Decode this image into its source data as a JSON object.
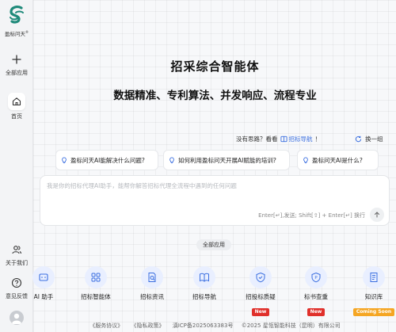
{
  "sidebar": {
    "logo_text": "盈标问天",
    "logo_mark": "®",
    "items": [
      {
        "label": "全部应用",
        "icon": "plus-icon"
      },
      {
        "label": "首页",
        "icon": "home-icon"
      },
      {
        "label": "关于我们",
        "icon": "users-icon"
      },
      {
        "label": "意见反馈",
        "icon": "help-icon"
      }
    ]
  },
  "main": {
    "title": "招采综合智能体",
    "subtitle": "数据精准、专利算法、并发响应、流程专业",
    "hint_prefix": "没有思路？看看",
    "hint_link": "招标导航",
    "hint_suffix": "！",
    "refresh_label": "换一组",
    "suggestions": [
      "盈标问天AI能解决什么问题?",
      "如何利用盈标问天开展AI赋能的培训?",
      "盈标问天AI是什么?"
    ],
    "input": {
      "placeholder": "我是你的招标代理AI助手，能帮你解答招标代理全流程中遇到的任何问题",
      "value": "",
      "send_hint": "Enter[↵],发送; Shift[⇧] + Enter[↵] 换行"
    },
    "all_apps_label": "全部应用",
    "apps": [
      {
        "label": "AI 助手",
        "icon": "assistant-icon",
        "badge": ""
      },
      {
        "label": "招标智能体",
        "icon": "grid-icon",
        "badge": ""
      },
      {
        "label": "招标资讯",
        "icon": "news-icon",
        "badge": ""
      },
      {
        "label": "招标导航",
        "icon": "book-icon",
        "badge": ""
      },
      {
        "label": "招投标质疑",
        "icon": "shield-icon",
        "badge": "New"
      },
      {
        "label": "标书查重",
        "icon": "check-doc-icon",
        "badge": "New"
      },
      {
        "label": "知识库",
        "icon": "knowledge-icon",
        "badge": "Coming Soon"
      }
    ],
    "footer": {
      "service_link": "《服务协议》",
      "privacy_link": "《隐私政策》",
      "icp": "滇ICP备2025063383号",
      "copyright": "©2025 星瓴智能科技（昆明）有限公司"
    }
  },
  "colors": {
    "accent": "#3b6fe0",
    "badge_new": "#e0302b",
    "badge_soon": "#f5a623",
    "logo": "#1f8a7a"
  }
}
